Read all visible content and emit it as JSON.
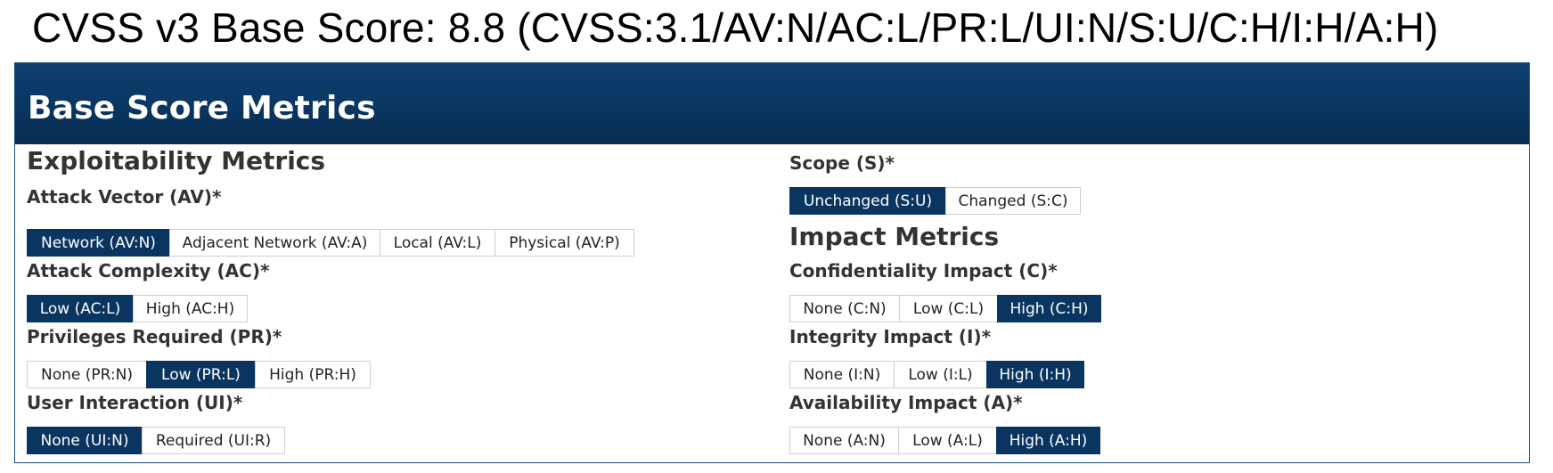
{
  "heading": "CVSS v3 Base Score: 8.8 (CVSS:3.1/AV:N/AC:L/PR:L/UI:N/S:U/C:H/I:H/A:H)",
  "panel": {
    "title": "Base Score Metrics"
  },
  "exploitability": {
    "title": "Exploitability Metrics",
    "attack_vector": {
      "label": "Attack Vector (AV)*",
      "options": [
        "Network (AV:N)",
        "Adjacent Network (AV:A)",
        "Local (AV:L)",
        "Physical (AV:P)"
      ],
      "selected": "Network (AV:N)"
    },
    "attack_complexity": {
      "label": "Attack Complexity (AC)*",
      "options": [
        "Low (AC:L)",
        "High (AC:H)"
      ],
      "selected": "Low (AC:L)"
    },
    "privileges_required": {
      "label": "Privileges Required (PR)*",
      "options": [
        "None (PR:N)",
        "Low (PR:L)",
        "High (PR:H)"
      ],
      "selected": "Low (PR:L)"
    },
    "user_interaction": {
      "label": "User Interaction (UI)*",
      "options": [
        "None (UI:N)",
        "Required (UI:R)"
      ],
      "selected": "None (UI:N)"
    }
  },
  "scope": {
    "label": "Scope (S)*",
    "options": [
      "Unchanged (S:U)",
      "Changed (S:C)"
    ],
    "selected": "Unchanged (S:U)"
  },
  "impact": {
    "title": "Impact Metrics",
    "confidentiality": {
      "label": "Confidentiality Impact (C)*",
      "options": [
        "None (C:N)",
        "Low (C:L)",
        "High (C:H)"
      ],
      "selected": "High (C:H)"
    },
    "integrity": {
      "label": "Integrity Impact (I)*",
      "options": [
        "None (I:N)",
        "Low (I:L)",
        "High (I:H)"
      ],
      "selected": "High (I:H)"
    },
    "availability": {
      "label": "Availability Impact (A)*",
      "options": [
        "None (A:N)",
        "Low (A:L)",
        "High (A:H)"
      ],
      "selected": "High (A:H)"
    }
  },
  "colors": {
    "header_bg": "#0a3560",
    "selected_bg": "#0a3560",
    "selected_text": "#ffffff",
    "option_border": "#cfcfcf"
  }
}
